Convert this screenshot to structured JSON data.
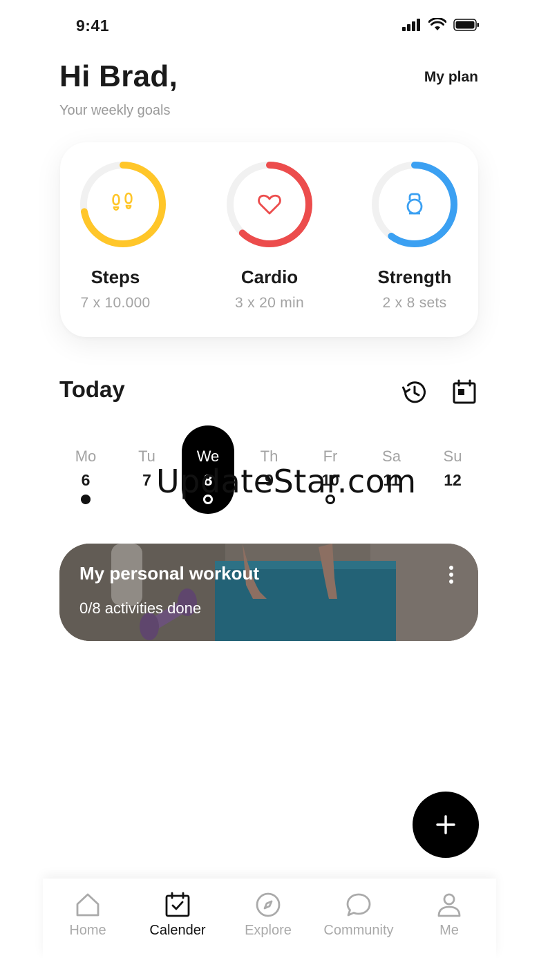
{
  "status": {
    "time": "9:41"
  },
  "header": {
    "greeting": "Hi Brad,",
    "subtitle": "Your weekly goals",
    "my_plan": "My plan"
  },
  "goals": [
    {
      "title": "Steps",
      "target": "7 x 10.000",
      "icon": "footsteps-icon",
      "color": "#FFC629",
      "progress": 0.72
    },
    {
      "title": "Cardio",
      "target": "3 x 20 min",
      "icon": "heart-icon",
      "color": "#EC4C4C",
      "progress": 0.62
    },
    {
      "title": "Strength",
      "target": "2 x 8 sets",
      "icon": "kettlebell-icon",
      "color": "#3BA0F2",
      "progress": 0.6
    }
  ],
  "today": {
    "title": "Today",
    "week": [
      {
        "name": "Mo",
        "num": "6",
        "dot": "filled",
        "selected": false
      },
      {
        "name": "Tu",
        "num": "7",
        "dot": "none",
        "selected": false
      },
      {
        "name": "We",
        "num": "8",
        "dot": "hollow",
        "selected": true
      },
      {
        "name": "Th",
        "num": "9",
        "dot": "none",
        "selected": false
      },
      {
        "name": "Fr",
        "num": "10",
        "dot": "hollow",
        "selected": false
      },
      {
        "name": "Sa",
        "num": "11",
        "dot": "none",
        "selected": false
      },
      {
        "name": "Su",
        "num": "12",
        "dot": "none",
        "selected": false
      }
    ]
  },
  "watermark": "UpdateStar.com",
  "workout": {
    "title": "My personal workout",
    "subtitle": "0/8 activities done"
  },
  "tabs": [
    {
      "label": "Home",
      "icon": "home-icon",
      "active": false
    },
    {
      "label": "Calender",
      "icon": "calendar-check-icon",
      "active": true
    },
    {
      "label": "Explore",
      "icon": "compass-icon",
      "active": false
    },
    {
      "label": "Community",
      "icon": "chat-bubble-icon",
      "active": false
    },
    {
      "label": "Me",
      "icon": "person-icon",
      "active": false
    }
  ],
  "colors": {
    "accent": "#000000",
    "muted": "#A3A3A3"
  }
}
